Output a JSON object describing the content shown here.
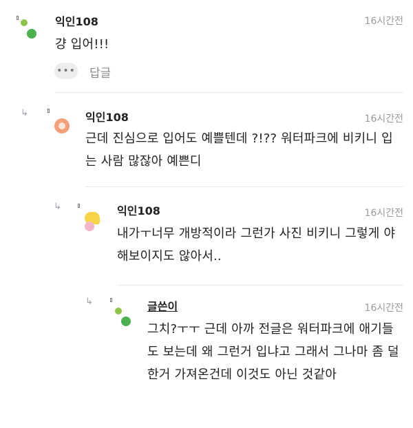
{
  "comments": [
    {
      "author": "익인108",
      "time": "16시간전",
      "body": "걍 입어!!!",
      "actions": {
        "more": "•••",
        "reply": "답글"
      }
    },
    {
      "author": "익인108",
      "time": "16시간전",
      "body": "근데 진심으로 입어도 예쁠텐데 ?!?? 워터파크에 비키니 입는 사람 많잖아 예쁜디"
    },
    {
      "author": "익인108",
      "time": "16시간전",
      "body": "내가ㅜ너무 개방적이라 그런가 사진 비키니 그렇게 야해보이지도 않아서.."
    },
    {
      "author": "글쓴이",
      "time": "16시간전",
      "body": "그치?ㅜㅜ 근데 아까 전글은 워터파크에 애기들도 보는데 왜 그런거 입냐고 그래서 그나마 좀 덜한거 가져온건데 이것도 아닌 것같아"
    }
  ],
  "icons": {
    "reply_arrow": "reply-arrow-icon",
    "avatar_green": "#4caf50",
    "avatar_lime": "#8bc34a",
    "avatar_orange": "#f3a07a",
    "avatar_yellow": "#f5d547",
    "avatar_pink": "#f3b6c8"
  }
}
